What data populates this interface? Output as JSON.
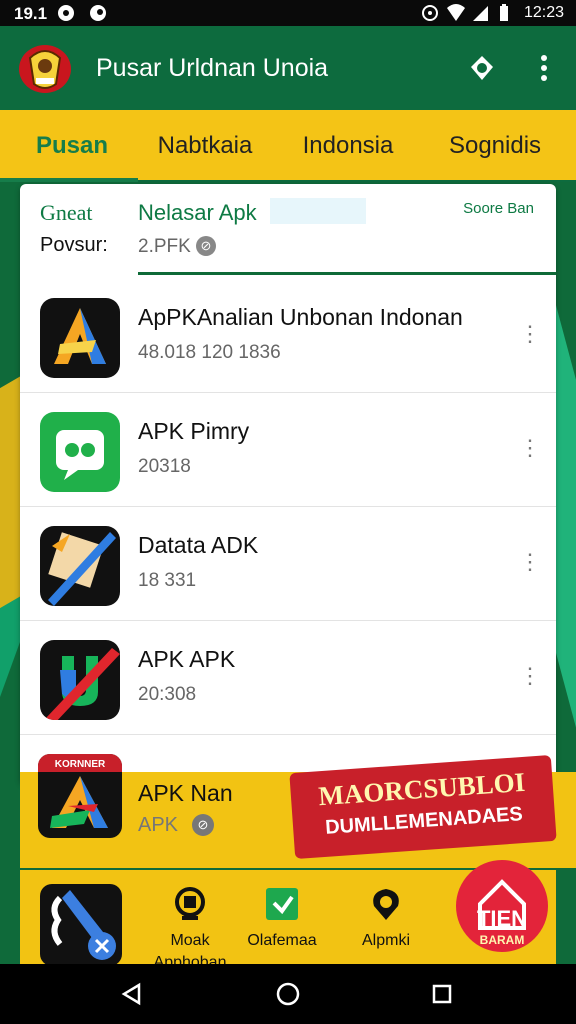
{
  "status_bar": {
    "time_left": "19.1",
    "time_right": "12:23",
    "icons": [
      "notification-icon",
      "record-icon",
      "hotspot-icon",
      "wifi-icon",
      "signal-icon",
      "battery-icon"
    ]
  },
  "app_bar": {
    "title": "Pusar Urldnan Unoia",
    "actions": [
      "notification-bell-icon",
      "more-vert-icon"
    ]
  },
  "tabs": [
    {
      "label": "Pusan",
      "active": true
    },
    {
      "label": "Nabtkaia",
      "active": false
    },
    {
      "label": "Indonsia",
      "active": false
    },
    {
      "label": "Sognidis",
      "active": false
    }
  ],
  "summary": {
    "label_1": "Gneat",
    "label_2": "Povsur:",
    "value_1": "Nelasar Apk",
    "value_2": "2.PFK",
    "sort_label": "Soore Ban"
  },
  "apps": [
    {
      "name": "ApPKAnalian Unbonan Indonan",
      "meta": "48.018 120 1836",
      "icon": "apk-analyzer-icon"
    },
    {
      "name": "APK Pimry",
      "meta": "20318",
      "icon": "apk-pimry-icon"
    },
    {
      "name": "Datata ADK",
      "meta": "18 331",
      "icon": "apr-data-icon"
    },
    {
      "name": "APK APK",
      "meta": "20:308",
      "icon": "apk-u-icon"
    }
  ],
  "promo": {
    "app_name": "APK Nan",
    "app_meta": "APK",
    "icon": "apk-nan-icon",
    "ad_line_1": "MAORCSUBLOI",
    "ad_line_2": "DUMLLEMENADAES",
    "ribbon_text": "KORNNER"
  },
  "shortcuts": [
    {
      "label": "Moak",
      "sublabel": "Apphoban",
      "icon": "medal-icon"
    },
    {
      "label": "Olafemaa",
      "icon": "download-card-icon"
    },
    {
      "label": "Alpmki",
      "icon": "location-pin-icon"
    }
  ],
  "badge": {
    "line_1": "TIEN",
    "line_2": "BARAM"
  },
  "colors": {
    "primary_green": "#0d6b3e",
    "accent_yellow": "#f4c416",
    "ad_red": "#c8202a"
  }
}
